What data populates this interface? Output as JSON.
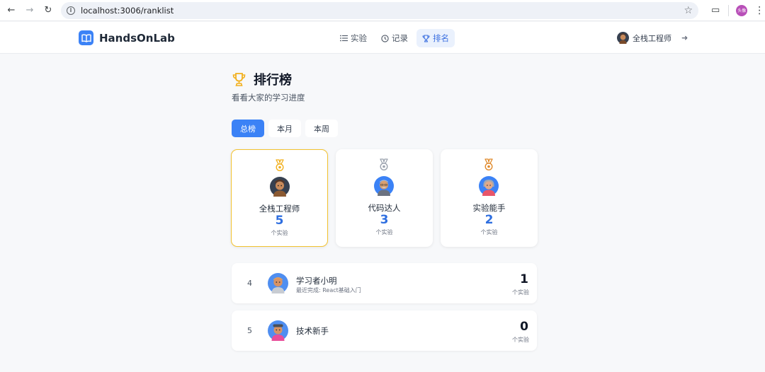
{
  "browser": {
    "url": "localhost:3006/ranklist",
    "profile_label": "头像"
  },
  "header": {
    "app_name": "HandsOnLab",
    "nav": [
      {
        "label": "实验",
        "icon": "list-icon",
        "active": false
      },
      {
        "label": "记录",
        "icon": "clock-icon",
        "active": false
      },
      {
        "label": "排名",
        "icon": "trophy-icon",
        "active": true
      }
    ],
    "user_name": "全栈工程师"
  },
  "page": {
    "title": "排行榜",
    "subtitle": "看看大家的学习进度",
    "tabs": [
      {
        "label": "总榜",
        "active": true
      },
      {
        "label": "本月",
        "active": false
      },
      {
        "label": "本周",
        "active": false
      }
    ]
  },
  "podium": [
    {
      "rank": 1,
      "name": "全栈工程师",
      "count": "5",
      "unit": "个实验",
      "medal_color": "#f2b01e"
    },
    {
      "rank": 2,
      "name": "代码达人",
      "count": "3",
      "unit": "个实验",
      "medal_color": "#9ca3af"
    },
    {
      "rank": 3,
      "name": "实验能手",
      "count": "2",
      "unit": "个实验",
      "medal_color": "#e08a2c"
    }
  ],
  "list": [
    {
      "rank": "4",
      "name": "学习者小明",
      "recent": "最近完成: React基础入门",
      "count": "1",
      "unit": "个实验"
    },
    {
      "rank": "5",
      "name": "技术新手",
      "recent": "",
      "count": "0",
      "unit": "个实验"
    }
  ],
  "colors": {
    "accent": "#3b82f6",
    "count_blue": "#2f6fe0",
    "first_border": "#f2c230",
    "trophy": "#f2b01e"
  }
}
